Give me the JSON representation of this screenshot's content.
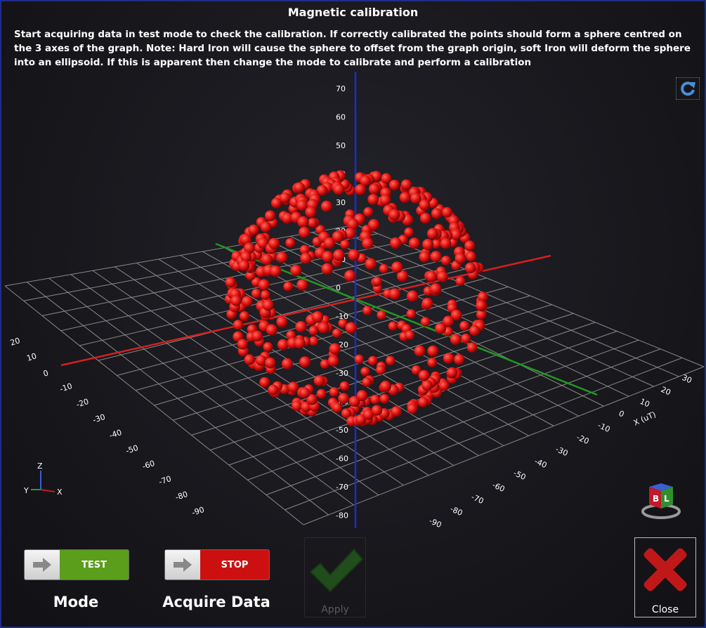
{
  "window": {
    "title": "Magnetic calibration",
    "description": "Start acquiring data in test mode to check the calibration. If correctly calibrated the points should form a sphere centred on the 3 axes of the graph. Note: Hard Iron will cause the sphere to offset from the graph origin, soft Iron will deform the sphere into an ellipsoid. If this is apparent then change the mode to calibrate and perform a calibration"
  },
  "plot": {
    "x_axis_label": "X (uT)",
    "z_ticks": [
      "70",
      "60",
      "50",
      "40",
      "30",
      "20",
      "10",
      "0",
      "-10",
      "-20",
      "-30",
      "-40",
      "-50",
      "-60",
      "-70",
      "-80"
    ],
    "left_ticks": [
      "20",
      "10",
      "0",
      "-10",
      "-20",
      "-30",
      "-40",
      "-50",
      "-60",
      "-70",
      "-80",
      "-90"
    ],
    "right_ticks": [
      "30",
      "20",
      "10",
      "0",
      "-10",
      "-20",
      "-30",
      "-40",
      "-50",
      "-60",
      "-70",
      "-80",
      "-90"
    ],
    "point_count": 420,
    "point_color": "#e01010"
  },
  "triad": {
    "z": "Z",
    "y": "Y",
    "x": "X"
  },
  "cube": {
    "left_face": "B",
    "right_face": "L",
    "top_face": ""
  },
  "controls": {
    "mode": {
      "state": "TEST",
      "label": "Mode",
      "color": "#5a9e1c"
    },
    "acquire": {
      "state": "STOP",
      "label": "Acquire Data",
      "color": "#cc1010"
    },
    "apply": {
      "label": "Apply"
    },
    "close": {
      "label": "Close"
    }
  }
}
